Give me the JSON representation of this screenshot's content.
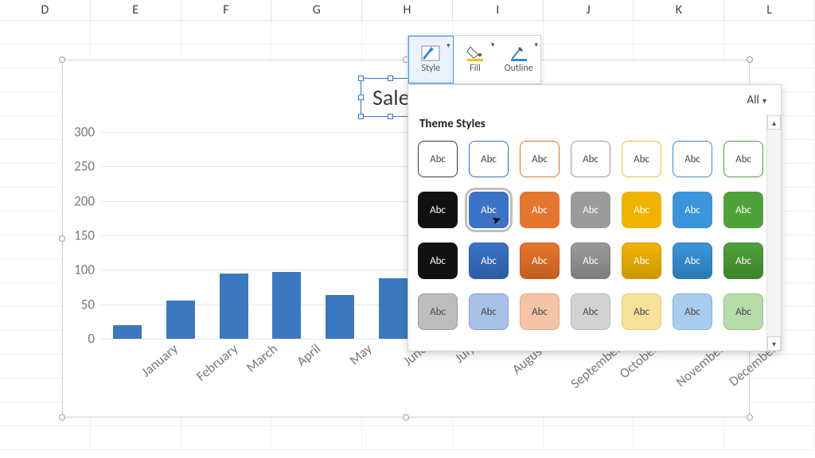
{
  "columns": [
    "D",
    "E",
    "F",
    "G",
    "H",
    "I",
    "J",
    "K",
    "L"
  ],
  "chart_data": {
    "type": "bar",
    "title": "Sale",
    "categories": [
      "January",
      "February",
      "March",
      "April",
      "May",
      "June",
      "July",
      "August",
      "September",
      "October",
      "November",
      "December"
    ],
    "values": [
      20,
      55,
      95,
      97,
      63,
      88,
      null,
      null,
      null,
      null,
      null,
      null
    ],
    "ylim": [
      0,
      300
    ],
    "yticks": [
      0,
      50,
      100,
      150,
      200,
      250,
      300
    ],
    "xlabel": "",
    "ylabel": ""
  },
  "minibar": {
    "style": "Style",
    "fill": "Fill",
    "outline": "Outline"
  },
  "gallery": {
    "all": "All",
    "section": "Theme Styles",
    "swatch_label": "Abc",
    "rows": [
      [
        {
          "bg": "#ffffff",
          "border": "#3a3a3a",
          "fg": "#444"
        },
        {
          "bg": "#ffffff",
          "border": "#2e6fbf",
          "fg": "#444"
        },
        {
          "bg": "#ffffff",
          "border": "#e0701a",
          "fg": "#444"
        },
        {
          "bg": "#ffffff",
          "border": "#9a9a9a",
          "fg": "#444"
        },
        {
          "bg": "#ffffff",
          "border": "#e6c32e",
          "fg": "#444"
        },
        {
          "bg": "#ffffff",
          "border": "#3a8bd8",
          "fg": "#444"
        },
        {
          "bg": "#ffffff",
          "border": "#4e9c3a",
          "fg": "#444"
        }
      ],
      [
        {
          "bg": "#111111",
          "border": "#111111",
          "fg": "#fff"
        },
        {
          "bg": "#3b73c7",
          "border": "#3b73c7",
          "fg": "#fff",
          "selected": true
        },
        {
          "bg": "#e6752e",
          "border": "#e6752e",
          "fg": "#fff"
        },
        {
          "bg": "#9b9b9b",
          "border": "#9b9b9b",
          "fg": "#fff"
        },
        {
          "bg": "#f0b400",
          "border": "#f0b400",
          "fg": "#fff"
        },
        {
          "bg": "#3a95da",
          "border": "#3a95da",
          "fg": "#fff"
        },
        {
          "bg": "#4ea23a",
          "border": "#4ea23a",
          "fg": "#fff"
        }
      ],
      [
        {
          "bg": "#111111",
          "border": "#111111",
          "fg": "#fff",
          "grad": true
        },
        {
          "bg": "#3b73c7",
          "border": "#2d5da5",
          "fg": "#fff",
          "grad": true
        },
        {
          "bg": "#e6752e",
          "border": "#c25f20",
          "fg": "#fff",
          "grad": true
        },
        {
          "bg": "#9b9b9b",
          "border": "#7d7d7d",
          "fg": "#fff",
          "grad": true
        },
        {
          "bg": "#f0b400",
          "border": "#cc9800",
          "fg": "#fff",
          "grad": true
        },
        {
          "bg": "#3a95da",
          "border": "#2d79b4",
          "fg": "#fff",
          "grad": true
        },
        {
          "bg": "#4ea23a",
          "border": "#3d842c",
          "fg": "#fff",
          "grad": true
        }
      ],
      [
        {
          "bg": "#bdbdbd",
          "border": "#9a9a9a",
          "fg": "#444"
        },
        {
          "bg": "#a9c1e6",
          "border": "#7ea0d2",
          "fg": "#444"
        },
        {
          "bg": "#f3c5a6",
          "border": "#e3a77f",
          "fg": "#444"
        },
        {
          "bg": "#d2d2d2",
          "border": "#b6b6b6",
          "fg": "#444"
        },
        {
          "bg": "#f6e19a",
          "border": "#e7cd6e",
          "fg": "#444"
        },
        {
          "bg": "#a8cdee",
          "border": "#7fb3de",
          "fg": "#444"
        },
        {
          "bg": "#b7dba9",
          "border": "#93c680",
          "fg": "#444"
        }
      ]
    ]
  }
}
